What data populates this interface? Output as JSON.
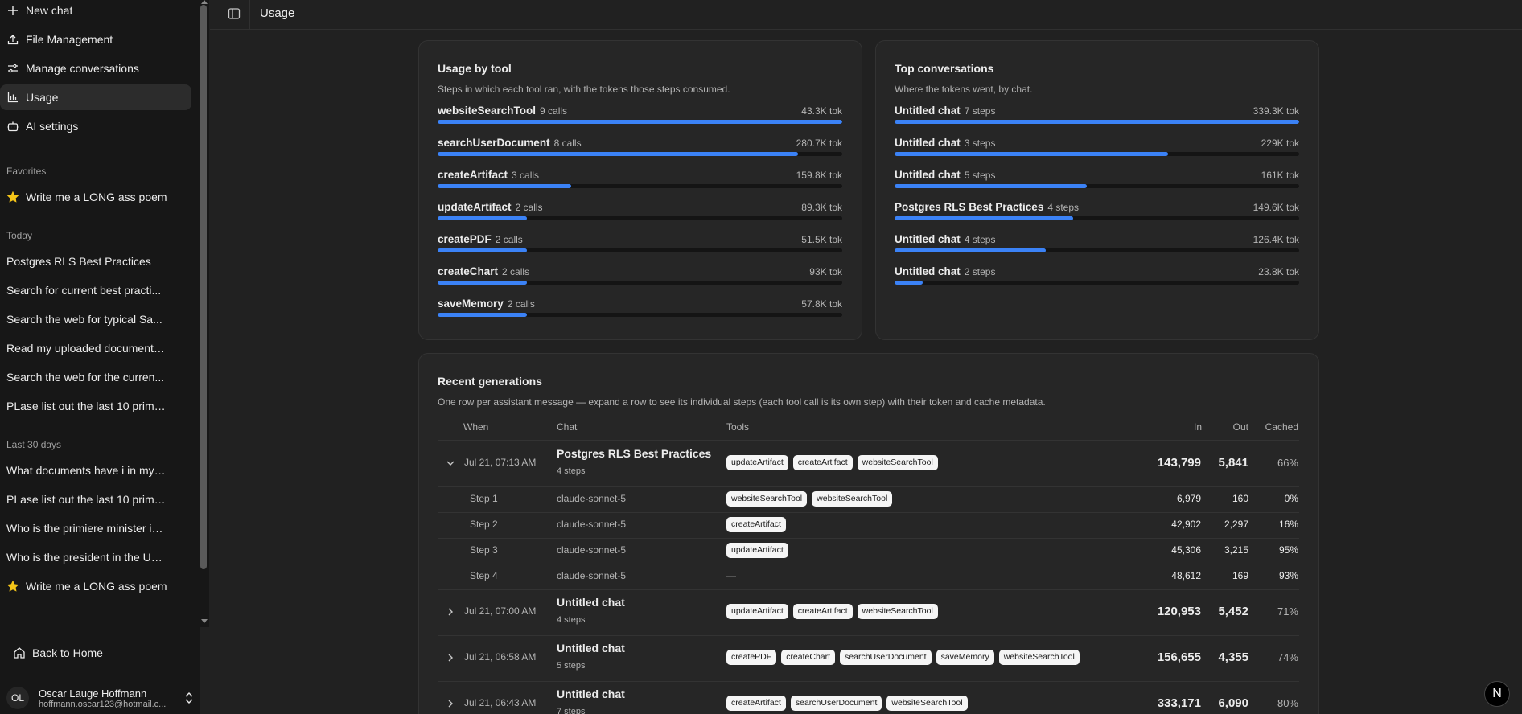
{
  "sidebar": {
    "nav": [
      {
        "label": "New chat",
        "icon": "plus-icon"
      },
      {
        "label": "File Management",
        "icon": "upload-icon"
      },
      {
        "label": "Manage conversations",
        "icon": "sliders-icon"
      },
      {
        "label": "Usage",
        "icon": "bar-chart-icon"
      },
      {
        "label": "AI settings",
        "icon": "robot-icon"
      }
    ],
    "favorites_label": "Favorites",
    "favorites": [
      "Write me a LONG ass poem"
    ],
    "today_label": "Today",
    "today": [
      "Postgres RLS Best Practices",
      "Search for current best practi...",
      "Search the web for typical Sa...",
      "Read my uploaded document ...",
      "Search the web for the curren...",
      "PLase list out the last 10 prime..."
    ],
    "last30_label": "Last 30 days",
    "last30": [
      "What documents have i in my ...",
      "PLase list out the last 10 prime...",
      "Who is the primiere minister in...",
      "Who is the president in the USA"
    ],
    "last30_fav": "Write me a LONG ass poem",
    "back_home": "Back to Home",
    "user": {
      "initials": "OL",
      "name": "Oscar Lauge Hoffmann",
      "email": "hoffmann.oscar123@hotmail.c..."
    }
  },
  "header": {
    "title": "Usage"
  },
  "usage_by_tool": {
    "title": "Usage by tool",
    "subtitle": "Steps in which each tool ran, with the tokens those steps consumed.",
    "rows": [
      {
        "name": "websiteSearchTool",
        "count": "9 calls",
        "tokens": "43.3K tok",
        "fill": 1.0
      },
      {
        "name": "searchUserDocument",
        "count": "8 calls",
        "tokens": "280.7K tok",
        "fill": 0.89
      },
      {
        "name": "createArtifact",
        "count": "3 calls",
        "tokens": "159.8K tok",
        "fill": 0.33
      },
      {
        "name": "updateArtifact",
        "count": "2 calls",
        "tokens": "89.3K tok",
        "fill": 0.22
      },
      {
        "name": "createPDF",
        "count": "2 calls",
        "tokens": "51.5K tok",
        "fill": 0.22
      },
      {
        "name": "createChart",
        "count": "2 calls",
        "tokens": "93K tok",
        "fill": 0.22
      },
      {
        "name": "saveMemory",
        "count": "2 calls",
        "tokens": "57.8K tok",
        "fill": 0.22
      }
    ]
  },
  "top_conversations": {
    "title": "Top conversations",
    "subtitle": "Where the tokens went, by chat.",
    "rows": [
      {
        "name": "Untitled chat",
        "count": "7 steps",
        "tokens": "339.3K tok",
        "fill": 1.0
      },
      {
        "name": "Untitled chat",
        "count": "3 steps",
        "tokens": "229K tok",
        "fill": 0.675
      },
      {
        "name": "Untitled chat",
        "count": "5 steps",
        "tokens": "161K tok",
        "fill": 0.475
      },
      {
        "name": "Postgres RLS Best Practices",
        "count": "4 steps",
        "tokens": "149.6K tok",
        "fill": 0.441
      },
      {
        "name": "Untitled chat",
        "count": "4 steps",
        "tokens": "126.4K tok",
        "fill": 0.373
      },
      {
        "name": "Untitled chat",
        "count": "2 steps",
        "tokens": "23.8K tok",
        "fill": 0.07
      }
    ]
  },
  "recent": {
    "title": "Recent generations",
    "subtitle": "One row per assistant message — expand a row to see its individual steps (each tool call is its own step) with their token and cache metadata.",
    "columns": {
      "when": "When",
      "chat": "Chat",
      "tools": "Tools",
      "in": "In",
      "out": "Out",
      "cached": "Cached"
    },
    "rows": [
      {
        "when": "Jul 21, 07:13 AM",
        "chat": "Postgres RLS Best Practices",
        "steps": "4 steps",
        "tools": [
          "updateArtifact",
          "createArtifact",
          "websiteSearchTool"
        ],
        "in": "143,799",
        "out": "5,841",
        "cached": "66%",
        "expanded": true,
        "substeps": [
          {
            "step": "Step 1",
            "model": "claude-sonnet-5",
            "tools": [
              "websiteSearchTool",
              "websiteSearchTool"
            ],
            "in": "6,979",
            "out": "160",
            "cached": "0%"
          },
          {
            "step": "Step 2",
            "model": "claude-sonnet-5",
            "tools": [
              "createArtifact"
            ],
            "in": "42,902",
            "out": "2,297",
            "cached": "16%"
          },
          {
            "step": "Step 3",
            "model": "claude-sonnet-5",
            "tools": [
              "updateArtifact"
            ],
            "in": "45,306",
            "out": "3,215",
            "cached": "95%"
          },
          {
            "step": "Step 4",
            "model": "claude-sonnet-5",
            "tools": [],
            "dash": "—",
            "in": "48,612",
            "out": "169",
            "cached": "93%"
          }
        ]
      },
      {
        "when": "Jul 21, 07:00 AM",
        "chat": "Untitled chat",
        "steps": "4 steps",
        "tools": [
          "updateArtifact",
          "createArtifact",
          "websiteSearchTool"
        ],
        "in": "120,953",
        "out": "5,452",
        "cached": "71%",
        "expanded": false
      },
      {
        "when": "Jul 21, 06:58 AM",
        "chat": "Untitled chat",
        "steps": "5 steps",
        "tools": [
          "createPDF",
          "createChart",
          "searchUserDocument",
          "saveMemory",
          "websiteSearchTool"
        ],
        "in": "156,655",
        "out": "4,355",
        "cached": "74%",
        "expanded": false
      },
      {
        "when": "Jul 21, 06:43 AM",
        "chat": "Untitled chat",
        "steps": "7 steps",
        "tools": [
          "createArtifact",
          "searchUserDocument",
          "websiteSearchTool"
        ],
        "in": "333,171",
        "out": "6,090",
        "cached": "80%",
        "expanded": false
      }
    ]
  },
  "badge": "N",
  "colors": {
    "accent": "#3b82f6",
    "background": "#212121",
    "sidebar": "#171717",
    "card": "#262626",
    "star": "#f5c518"
  }
}
